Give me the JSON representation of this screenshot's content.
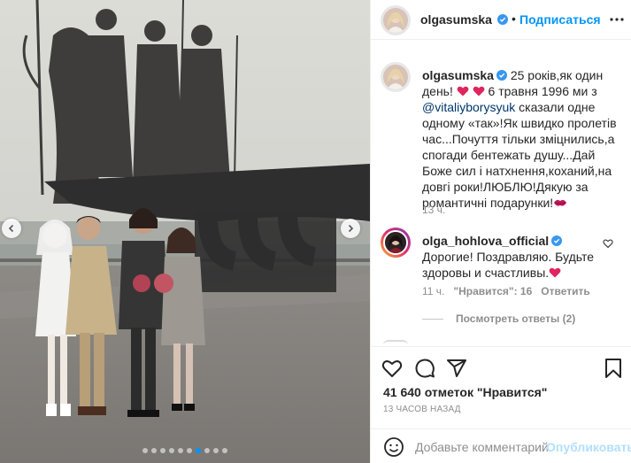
{
  "post": {
    "username": "olgasumska",
    "follow_label": "Подписаться",
    "separator": "•",
    "caption": {
      "username": "olgasumska",
      "text_part1": "25 років,як один день!",
      "text_part2": "6 травня 1996 ми з",
      "mention": "@vitaliyborysyuk",
      "text_part3": "сказали одне одному «так»!Як швидко пролетів час...Почуття тільки зміцнились,а спогади бентежать душу...Дай Боже сил і натхнення,коханий,на довгі роки!ЛЮБЛЮ!Дякую за романтичні подарунки!",
      "time": "13 ч."
    },
    "comment": {
      "username": "olga_hohlova_official",
      "text": "Дорогие! Поздравляю. Будьте здоровы и счастливы.",
      "time": "11 ч.",
      "likes": "\"Нравится\": 16",
      "reply_label": "Ответить",
      "view_replies": "Посмотреть ответы (2)"
    },
    "likes": "41 640 отметок \"Нравится\"",
    "timestamp": "13 ЧАСОВ НАЗАД",
    "comment_placeholder": "Добавьте комментарий...",
    "publish_label": "Опубликовать"
  },
  "carousel": {
    "total": 10,
    "active_index": 6
  },
  "colors": {
    "accent": "#0095f6",
    "publish_disabled": "#b2dffc",
    "text": "#262626",
    "muted": "#8e8e8e",
    "heart": "#ed4956"
  },
  "icons": [
    "chevron-left-icon",
    "chevron-right-icon",
    "verified-icon",
    "more-icon",
    "heart-icon",
    "comment-icon",
    "share-icon",
    "bookmark-icon",
    "emoji-icon"
  ]
}
